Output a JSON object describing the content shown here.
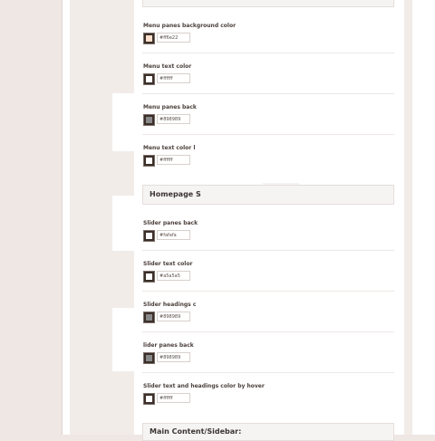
{
  "sections": {
    "homepage_slider": "Homepage S",
    "main_content": "Main Content/Sidebar:"
  },
  "fields": [
    {
      "label": "Menu panes background color",
      "hex": "#ff6e22",
      "swatch": "#ffe0cc"
    },
    {
      "label": "Menu text color",
      "hex": "#ffffff",
      "swatch": "#ffffff"
    },
    {
      "label": "Menu panes back",
      "hex": "#898989",
      "swatch": "#898989"
    },
    {
      "label": "Menu text color l",
      "hex": "#ffffff",
      "swatch": "#ffffff"
    },
    {
      "label": "Slider panes back",
      "hex": "#fafafa",
      "swatch": "#fafafa"
    },
    {
      "label": "Slider text color",
      "hex": "#a5a5a5",
      "swatch": "#ffffff"
    },
    {
      "label": "Slider headings c",
      "hex": "#898989",
      "swatch": "#898989"
    },
    {
      "label": "lider panes back",
      "hex": "#898989",
      "swatch": "#898989"
    },
    {
      "label": "Slider text and headings color by hover",
      "hex": "#ffffff",
      "swatch": "#ffffff"
    }
  ]
}
